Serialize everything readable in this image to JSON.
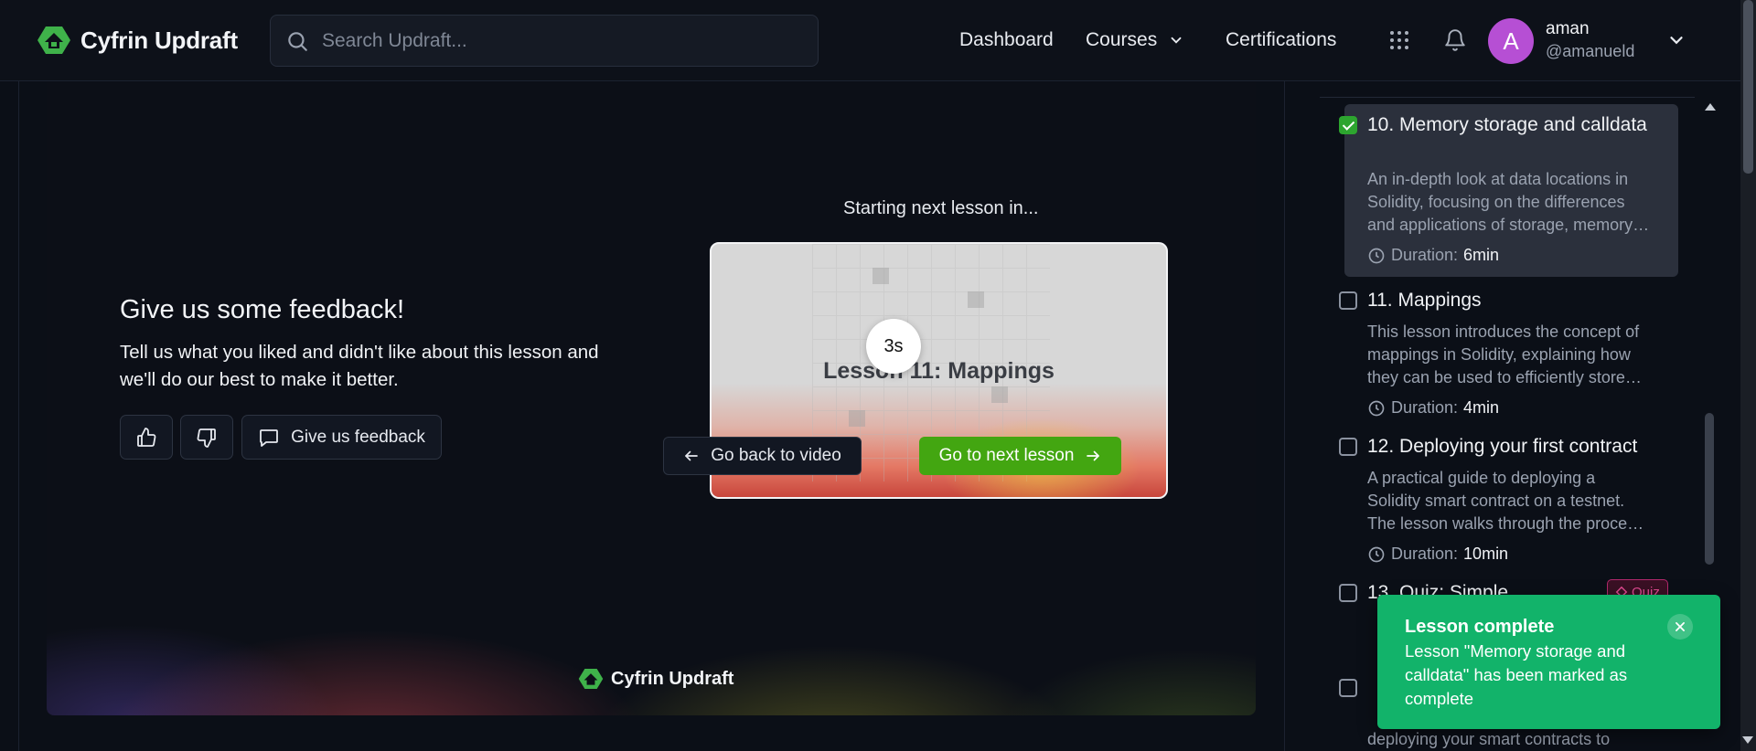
{
  "app": {
    "name": "Cyfrin Updraft"
  },
  "search": {
    "placeholder": "Search Updraft..."
  },
  "nav": {
    "dashboard": "Dashboard",
    "courses": "Courses",
    "certifications": "Certifications"
  },
  "user": {
    "initial": "A",
    "name": "aman",
    "handle": "@amanueld"
  },
  "feedback": {
    "title": "Give us some feedback!",
    "description": "Tell us what you liked and didn't like about this lesson and we'll do our best to make it better.",
    "give_label": "Give us feedback"
  },
  "next": {
    "caption": "Starting next lesson in...",
    "lesson_title": "Lesson 11: Mappings",
    "countdown": "3s",
    "back_label": "Go back to video",
    "next_label": "Go to next lesson"
  },
  "panel_brand": "Cyfrin Updraft",
  "sidebar": {
    "duration_label": "Duration:",
    "lessons": [
      {
        "title": "10. Memory storage and calldata",
        "description": "An in-depth look at data locations in Solidity, focusing on the differences and applications of storage, memory and calldata.",
        "duration": "6min",
        "checked": true
      },
      {
        "title": "11. Mappings",
        "description": "This lesson introduces the concept of mappings in Solidity, explaining how they can be used to efficiently store and retrieve data.",
        "duration": "4min",
        "checked": false
      },
      {
        "title": "12. Deploying your first contract",
        "description": "A practical guide to deploying a Solidity smart contract on a testnet. The lesson walks through the process step by step.",
        "duration": "10min",
        "checked": false
      },
      {
        "title": "13. Quiz: Simple",
        "badge": "Quiz",
        "checked": false
      },
      {
        "description": "deploying your smart contracts to",
        "checked": false
      }
    ]
  },
  "toast": {
    "title": "Lesson complete",
    "body": "Lesson \"Memory storage and calldata\" has been marked as complete"
  },
  "colors": {
    "accent_green": "#43a611",
    "toast_green": "#12b36a",
    "avatar_purple": "#b64fd4",
    "quiz_pink": "#e24a93"
  }
}
